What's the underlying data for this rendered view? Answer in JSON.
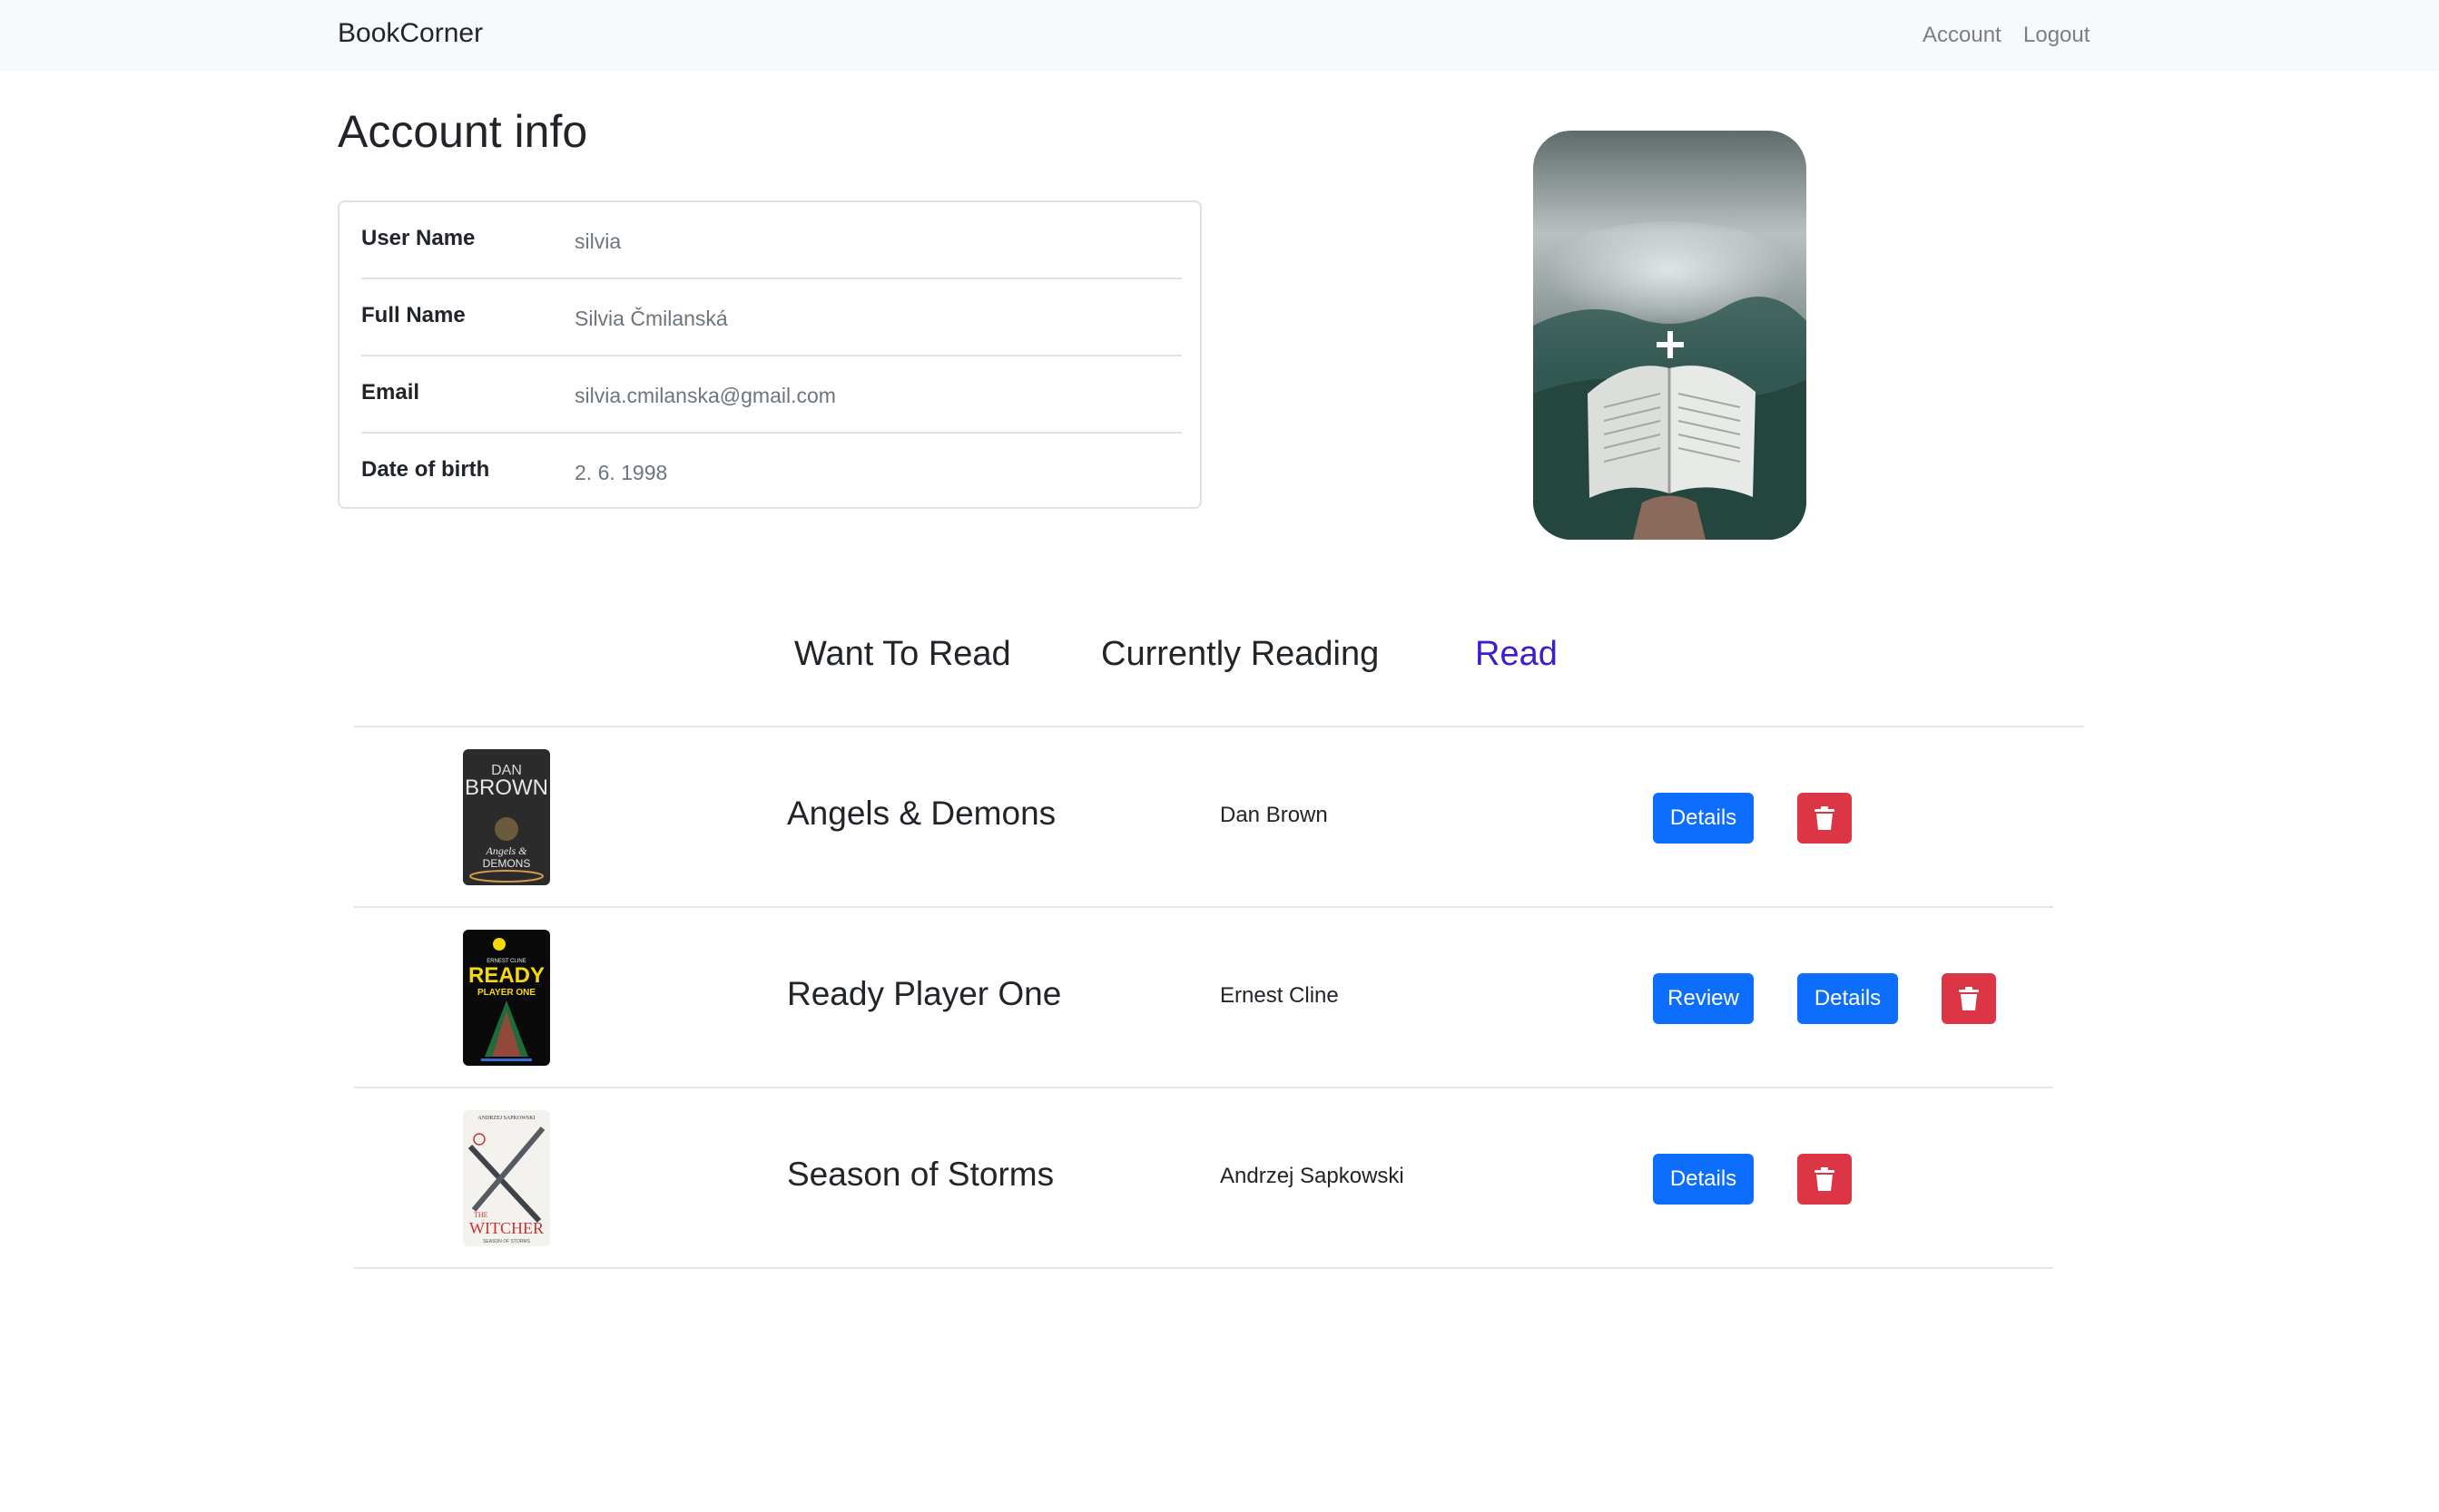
{
  "navbar": {
    "brand": "BookCorner",
    "links": [
      "Account",
      "Logout"
    ]
  },
  "page_title": "Account info",
  "account_info": {
    "rows": [
      {
        "label": "User Name",
        "value": "silvia"
      },
      {
        "label": "Full Name",
        "value": "Silvia Čmilanská"
      },
      {
        "label": "Email",
        "value": "silvia.cmilanska@gmail.com"
      },
      {
        "label": "Date of birth",
        "value": "2. 6. 1998"
      }
    ]
  },
  "profile_photo": {
    "overlay_icon": "plus-icon",
    "depiction": "open-book-forest-photo"
  },
  "tabs": [
    {
      "label": "Want To Read",
      "active": false
    },
    {
      "label": "Currently Reading",
      "active": false
    },
    {
      "label": "Read",
      "active": true
    }
  ],
  "colors": {
    "active_tab": "#3b1ed0",
    "primary_button": "#0d6efd",
    "danger_button": "#dc3545",
    "navbar_bg": "#f8f9fa"
  },
  "books": [
    {
      "title": "Angels & Demons",
      "author": "Dan Brown",
      "cover_text": [
        "DAN",
        "BROWN",
        "Angels &",
        "DEMONS"
      ],
      "actions": [
        "Details"
      ],
      "delete_icon": "trash-icon"
    },
    {
      "title": "Ready Player One",
      "author": "Ernest Cline",
      "cover_text": [
        "ERNEST CLINE",
        "READY",
        "PLAYER ONE"
      ],
      "actions": [
        "Review",
        "Details"
      ],
      "delete_icon": "trash-icon"
    },
    {
      "title": "Season of Storms",
      "author": "Andrzej Sapkowski",
      "cover_text": [
        "ANDRZEJ SAPKOWSKI",
        "THE",
        "WITCHER",
        "SEASON OF STORMS"
      ],
      "actions": [
        "Details"
      ],
      "delete_icon": "trash-icon"
    }
  ]
}
